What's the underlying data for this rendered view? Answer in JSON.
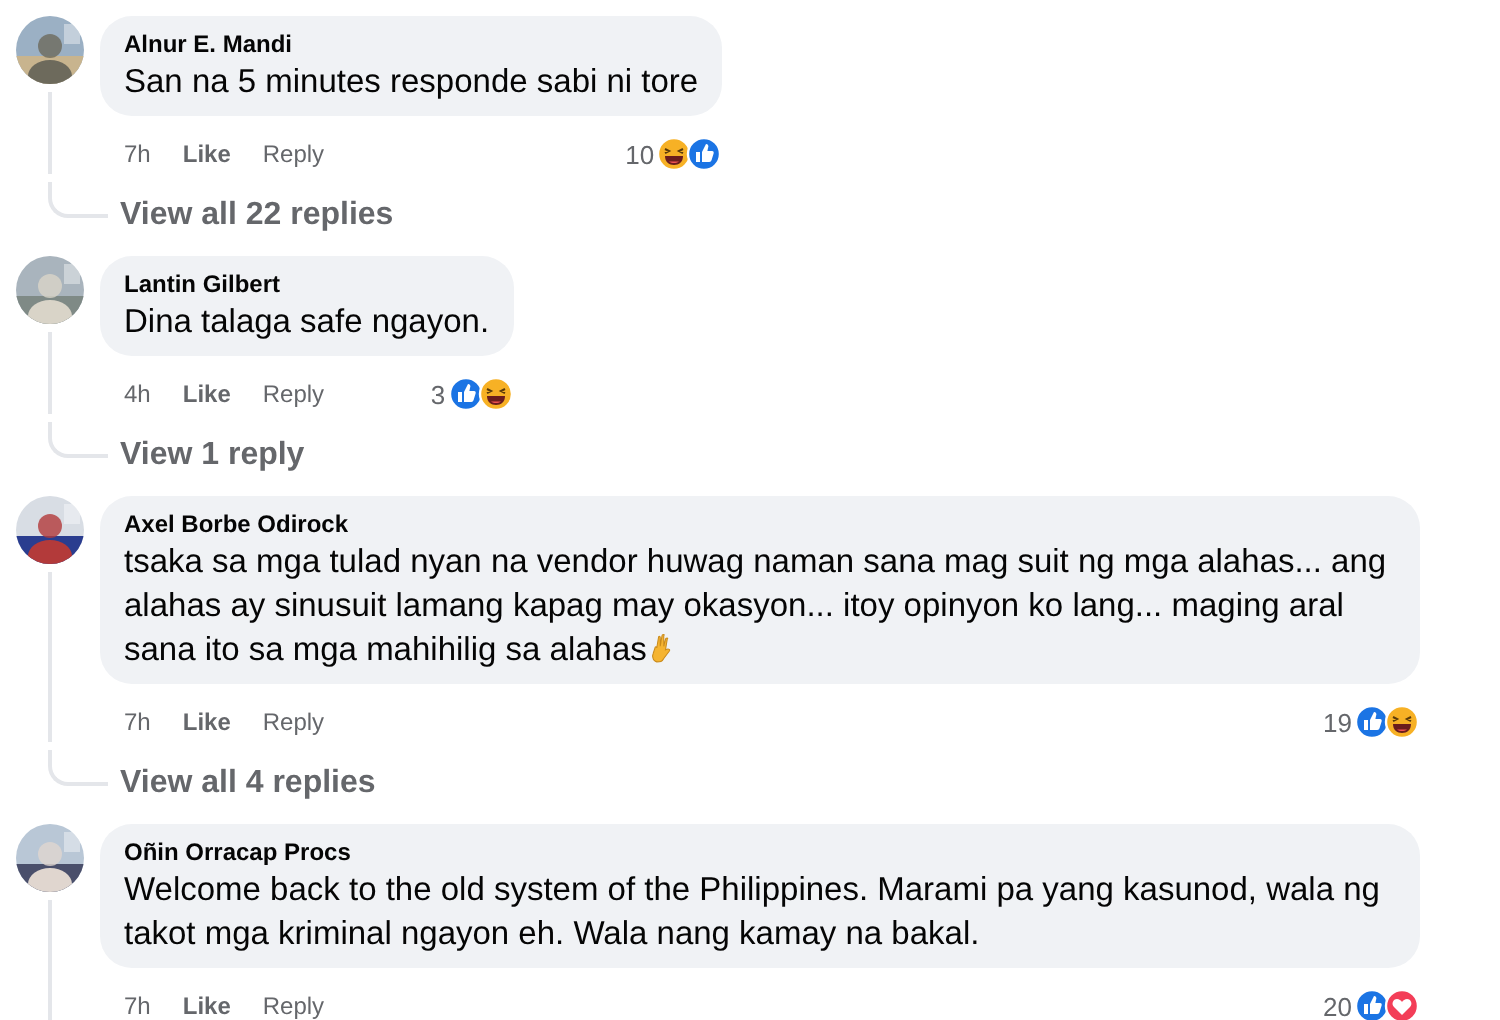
{
  "comments": [
    {
      "author": "Alnur E. Mandi",
      "text": "San na 5 minutes responde sabi ni tore",
      "time": "7h",
      "like": "Like",
      "reply": "Reply",
      "reaction_count": "10",
      "reactions": [
        {
          "kind": "haha"
        },
        {
          "kind": "like"
        }
      ],
      "replies_link": "View all 22 replies"
    },
    {
      "author": "Lantin Gilbert",
      "text": "Dina talaga safe ngayon.",
      "time": "4h",
      "like": "Like",
      "reply": "Reply",
      "reaction_count": "3",
      "reactions": [
        {
          "kind": "like"
        },
        {
          "kind": "haha"
        }
      ],
      "replies_link": "View 1 reply"
    },
    {
      "author": "Axel Borbe Odirock",
      "text": "tsaka sa mga tulad nyan na vendor huwag naman sana mag suit ng mga alahas... ang alahas ay sinusuit lamang kapag may okasyon... itoy opinyon ko lang... maging aral sana ito sa mga mahihilig sa alahas",
      "trailing_emoji": {
        "kind": "ok_hand"
      },
      "time": "7h",
      "like": "Like",
      "reply": "Reply",
      "reaction_count": "19",
      "reactions": [
        {
          "kind": "like"
        },
        {
          "kind": "haha"
        }
      ],
      "replies_link": "View all 4 replies"
    },
    {
      "author": "Oñin Orracap Procs",
      "text": "Welcome back to the old system of the Philippines. Marami pa yang kasunod, wala ng takot mga kriminal ngayon eh. Wala nang kamay na bakal.",
      "time": "7h",
      "like": "Like",
      "reply": "Reply",
      "reaction_count": "20",
      "reactions": [
        {
          "kind": "like"
        },
        {
          "kind": "love"
        }
      ]
    }
  ]
}
